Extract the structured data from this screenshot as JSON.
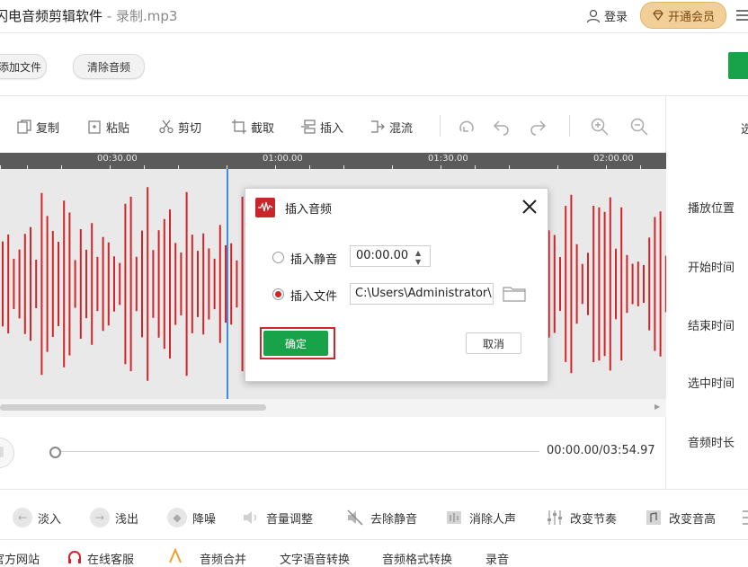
{
  "titlebar": {
    "app_name": "闪电音频剪辑软件",
    "separator": " - ",
    "file_name": "录制.mp3",
    "login_label": "登录",
    "vip_label": "开通会员"
  },
  "actions": {
    "add_file_label": "添加文件",
    "clear_audio_label": "清除音频"
  },
  "toolbar": {
    "copy": "复制",
    "paste": "粘贴",
    "cut": "剪切",
    "trim": "截取",
    "insert": "插入",
    "mix": "混流"
  },
  "timeline": {
    "ticks": [
      "00:30.00",
      "01:00.00",
      "01:30.00",
      "02:00.00"
    ]
  },
  "player": {
    "time_readout": "00:00.00/03:54.97"
  },
  "right_panel": {
    "top_cut": "选",
    "play_position": "播放位置",
    "start_time": "开始时间",
    "end_time": "结束时间",
    "selected_time": "选中时间",
    "audio_duration": "音频时长"
  },
  "effects": [
    {
      "label": "淡入"
    },
    {
      "label": "浅出"
    },
    {
      "label": "降噪"
    },
    {
      "label": "音量调整"
    },
    {
      "label": "去除静音"
    },
    {
      "label": "消除人声"
    },
    {
      "label": "改变节奏"
    },
    {
      "label": "改变音高"
    }
  ],
  "footer": {
    "official_site": "官方网站",
    "online_service": "在线客服",
    "audio_merge": "音频合并",
    "tts": "文字语音转换",
    "format_convert": "音频格式转换",
    "record": "录音"
  },
  "dialog": {
    "title": "插入音频",
    "option_silence": "插入静音",
    "silence_value": "00:00.00",
    "option_file": "插入文件",
    "file_value": "C:\\Users\\Administrator\\",
    "ok_label": "确定",
    "cancel_label": "取消"
  },
  "colors": {
    "accent_green": "#18a34a",
    "waveform_red": "#d0252b",
    "vip_gold": "#f1cf97",
    "playhead_blue": "#3a8fe0"
  }
}
